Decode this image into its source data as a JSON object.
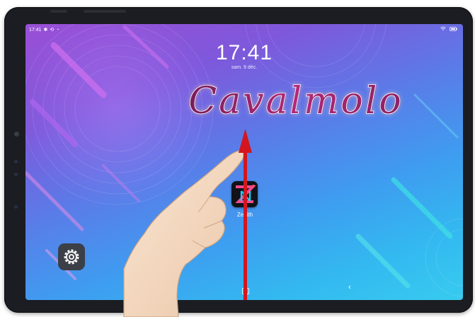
{
  "status_bar": {
    "time": "17:41",
    "left_icons": [
      "bluetooth-icon",
      "sync-icon",
      "alarm-icon"
    ],
    "right_icons": [
      "wifi-icon",
      "battery-icon"
    ]
  },
  "lock_clock": {
    "time": "17:41",
    "date": "sam. 9 déc."
  },
  "brand_overlay": {
    "text": "Cavalmolo"
  },
  "home": {
    "apps": [
      {
        "label": "Zenith",
        "icon": "zenith-app-icon"
      }
    ],
    "settings_icon": "gear-icon"
  },
  "nav_bar": {
    "icons": [
      "recents-icon",
      "back-icon"
    ]
  },
  "gesture": {
    "description_icon": "swipe-up-arrow-icon",
    "hand_icon": "pointing-hand-icon"
  },
  "colors": {
    "arrow": "#d3161e",
    "wallpaper_top": "#9a4fd6",
    "wallpaper_bottom": "#38cbef",
    "bezel": "#1b1d22"
  }
}
